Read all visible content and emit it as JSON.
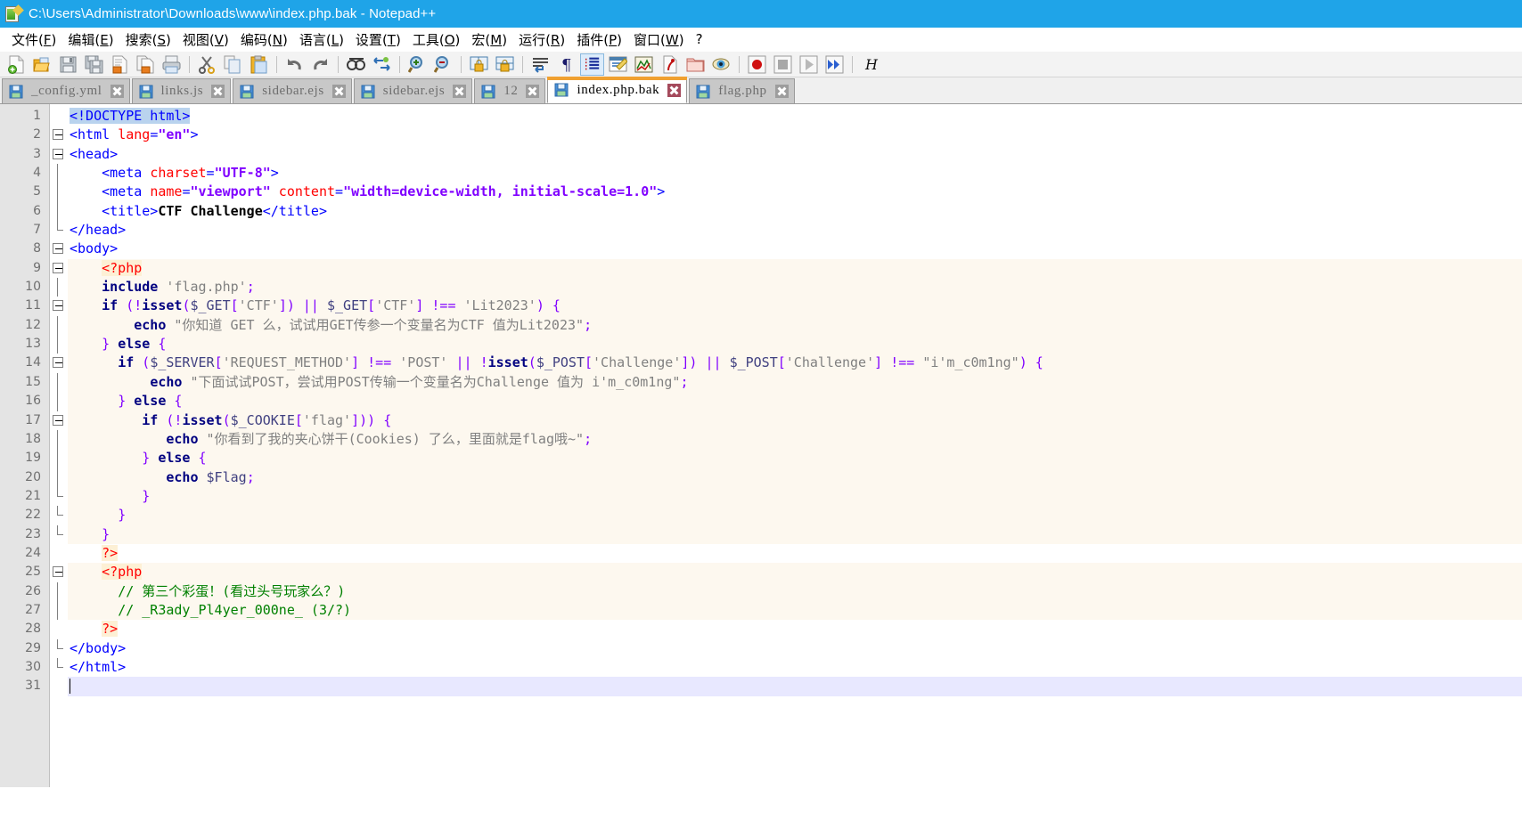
{
  "window": {
    "title": "C:\\Users\\Administrator\\Downloads\\www\\index.php.bak - Notepad++",
    "app_icon": "notepad-plus-plus-icon",
    "titlebar_color": "#1fa4e8"
  },
  "menubar": {
    "items": [
      {
        "label": "文件",
        "mnemonic": "F"
      },
      {
        "label": "编辑",
        "mnemonic": "E"
      },
      {
        "label": "搜索",
        "mnemonic": "S"
      },
      {
        "label": "视图",
        "mnemonic": "V"
      },
      {
        "label": "编码",
        "mnemonic": "N"
      },
      {
        "label": "语言",
        "mnemonic": "L"
      },
      {
        "label": "设置",
        "mnemonic": "T"
      },
      {
        "label": "工具",
        "mnemonic": "O"
      },
      {
        "label": "宏",
        "mnemonic": "M"
      },
      {
        "label": "运行",
        "mnemonic": "R"
      },
      {
        "label": "插件",
        "mnemonic": "P"
      },
      {
        "label": "窗口",
        "mnemonic": "W"
      },
      {
        "label": "?",
        "mnemonic": ""
      }
    ]
  },
  "toolbar": {
    "buttons": [
      {
        "name": "new-file-icon"
      },
      {
        "name": "open-file-icon"
      },
      {
        "name": "save-icon"
      },
      {
        "name": "save-all-icon"
      },
      {
        "name": "close-file-icon"
      },
      {
        "name": "close-all-files-icon"
      },
      {
        "name": "print-icon"
      },
      {
        "name": "separator"
      },
      {
        "name": "cut-icon"
      },
      {
        "name": "copy-icon"
      },
      {
        "name": "paste-icon"
      },
      {
        "name": "separator"
      },
      {
        "name": "undo-icon"
      },
      {
        "name": "redo-icon"
      },
      {
        "name": "separator"
      },
      {
        "name": "find-icon"
      },
      {
        "name": "replace-icon"
      },
      {
        "name": "separator"
      },
      {
        "name": "zoom-in-icon"
      },
      {
        "name": "zoom-out-icon"
      },
      {
        "name": "separator"
      },
      {
        "name": "sync-vertical-scroll-icon"
      },
      {
        "name": "sync-horizontal-scroll-icon"
      },
      {
        "name": "separator"
      },
      {
        "name": "word-wrap-icon"
      },
      {
        "name": "show-all-characters-icon"
      },
      {
        "name": "show-indent-guide-icon"
      },
      {
        "name": "user-defined-language-icon"
      },
      {
        "name": "document-map-icon"
      },
      {
        "name": "function-list-icon"
      },
      {
        "name": "folder-as-workspace-icon"
      },
      {
        "name": "monitoring-icon"
      },
      {
        "name": "separator"
      },
      {
        "name": "record-macro-icon"
      },
      {
        "name": "stop-recording-macro-icon"
      },
      {
        "name": "play-macro-icon"
      },
      {
        "name": "run-macro-multiple-times-icon"
      },
      {
        "name": "separator"
      },
      {
        "name": "italic-h-icon",
        "label": "H"
      }
    ]
  },
  "tabs": [
    {
      "label": "_config.yml",
      "active": false
    },
    {
      "label": "links.js",
      "active": false
    },
    {
      "label": "sidebar.ejs",
      "active": false
    },
    {
      "label": "sidebar.ejs",
      "active": false
    },
    {
      "label": "12",
      "active": false
    },
    {
      "label": "index.php.bak",
      "active": true
    },
    {
      "label": "flag.php",
      "active": false
    }
  ],
  "editor": {
    "total_lines": 31,
    "caret_line": 31,
    "line_numbers": [
      1,
      2,
      3,
      4,
      5,
      6,
      7,
      8,
      9,
      10,
      11,
      12,
      13,
      14,
      15,
      16,
      17,
      18,
      19,
      20,
      21,
      22,
      23,
      24,
      25,
      26,
      27,
      28,
      29,
      30,
      31
    ],
    "lines": [
      {
        "n": 1,
        "text": "<!DOCTYPE html>"
      },
      {
        "n": 2,
        "text": "<html lang=\"en\">"
      },
      {
        "n": 3,
        "text": "<head>"
      },
      {
        "n": 4,
        "text": "    <meta charset=\"UTF-8\">"
      },
      {
        "n": 5,
        "text": "    <meta name=\"viewport\" content=\"width=device-width, initial-scale=1.0\">"
      },
      {
        "n": 6,
        "text": "    <title>CTF Challenge</title>"
      },
      {
        "n": 7,
        "text": "</head>"
      },
      {
        "n": 8,
        "text": "<body>"
      },
      {
        "n": 9,
        "text": "    <?php"
      },
      {
        "n": 10,
        "text": "    include 'flag.php';"
      },
      {
        "n": 11,
        "text": "    if (!isset($_GET['CTF']) || $_GET['CTF'] !== 'Lit2023') {"
      },
      {
        "n": 12,
        "text": "        echo \"你知道 GET 么，试试用GET传参一个变量名为CTF 值为Lit2023\";"
      },
      {
        "n": 13,
        "text": "    } else {"
      },
      {
        "n": 14,
        "text": "      if ($_SERVER['REQUEST_METHOD'] !== 'POST' || !isset($_POST['Challenge']) || $_POST['Challenge'] !== \"i'm_c0m1ng\") {"
      },
      {
        "n": 15,
        "text": "          echo \"下面试试POST，尝试用POST传输一个变量名为Challenge 值为 i'm_c0m1ng\";"
      },
      {
        "n": 16,
        "text": "      } else {"
      },
      {
        "n": 17,
        "text": "         if (!isset($_COOKIE['flag'])) {"
      },
      {
        "n": 18,
        "text": "            echo \"你看到了我的夹心饼干(Cookies) 了么，里面就是flag哦~\";"
      },
      {
        "n": 19,
        "text": "         } else {"
      },
      {
        "n": 20,
        "text": "            echo $Flag;"
      },
      {
        "n": 21,
        "text": "         }"
      },
      {
        "n": 22,
        "text": "      }"
      },
      {
        "n": 23,
        "text": "    }"
      },
      {
        "n": 24,
        "text": "    ?>"
      },
      {
        "n": 25,
        "text": "    <?php"
      },
      {
        "n": 26,
        "text": "      // 第三个彩蛋！(看过头号玩家么？)"
      },
      {
        "n": 27,
        "text": "      // _R3ady_Pl4yer_000ne_ (3/?)"
      },
      {
        "n": 28,
        "text": "    ?>"
      },
      {
        "n": 29,
        "text": "</body>"
      },
      {
        "n": 30,
        "text": "</html>"
      },
      {
        "n": 31,
        "text": ""
      }
    ],
    "syntax_colors": {
      "html_tag": "#0000ff",
      "attribute_name": "#ff0000",
      "attribute_value": "#8000ff",
      "php_delimiter": "#ff0000",
      "php_keyword": "#000080",
      "php_variable": "#404080",
      "php_string": "#808080",
      "php_operator": "#8000ff",
      "php_comment": "#008000",
      "php_block_background": "#fdf8ef",
      "caret_line_background": "#e8e8ff"
    }
  }
}
